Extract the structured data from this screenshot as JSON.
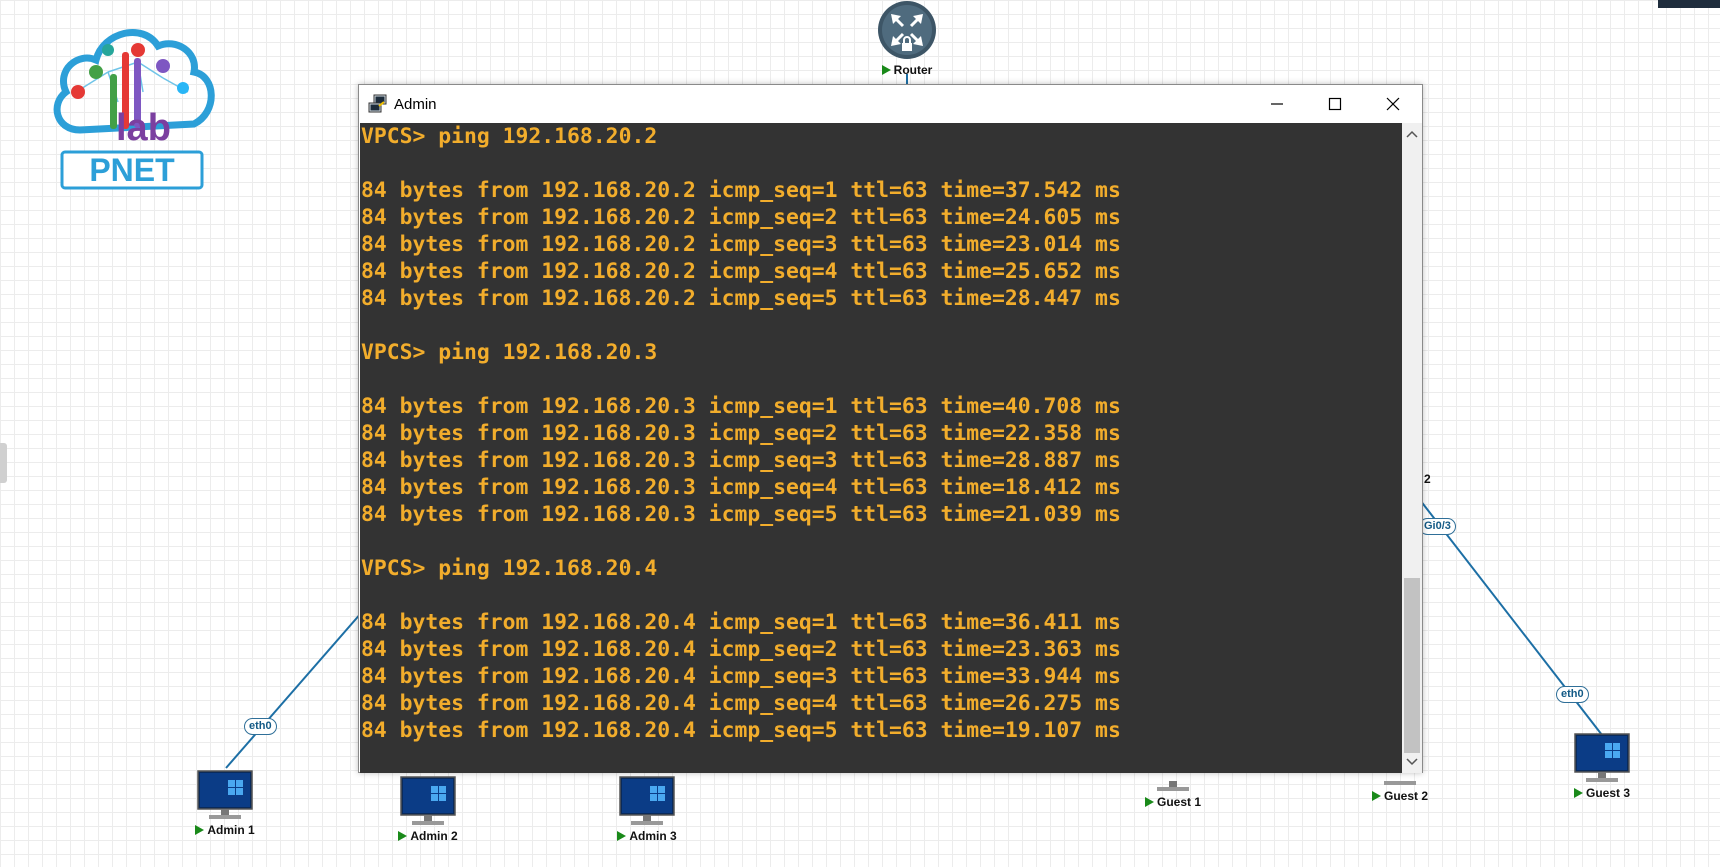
{
  "logo": {
    "text": "PNET",
    "sub_text": "lab"
  },
  "nodes": {
    "router": {
      "label": "Router",
      "icon": "router-icon"
    },
    "admin1": {
      "label": "Admin 1",
      "icon": "pc-icon"
    },
    "admin2": {
      "label": "Admin 2",
      "icon": "pc-icon"
    },
    "admin3": {
      "label": "Admin 3",
      "icon": "pc-icon"
    },
    "guest1": {
      "label": "Guest 1",
      "icon": "pc-icon"
    },
    "guest2": {
      "label": "Guest 2",
      "icon": "pc-icon"
    },
    "guest3": {
      "label": "Guest 3",
      "icon": "pc-icon"
    }
  },
  "interfaces": {
    "admin1_eth": "eth0",
    "guest3_eth": "eth0",
    "switch_gi": "Gi0/3",
    "switch_partial": "2"
  },
  "window": {
    "title": "Admin",
    "icon": "putty-icon",
    "controls": [
      "minimize-icon",
      "maximize-icon",
      "close-icon"
    ]
  },
  "terminal": {
    "text_color": "#f2ad2c",
    "background": "#333333",
    "lines": [
      "VPCS> ping 192.168.20.2",
      "",
      "84 bytes from 192.168.20.2 icmp_seq=1 ttl=63 time=37.542 ms",
      "84 bytes from 192.168.20.2 icmp_seq=2 ttl=63 time=24.605 ms",
      "84 bytes from 192.168.20.2 icmp_seq=3 ttl=63 time=23.014 ms",
      "84 bytes from 192.168.20.2 icmp_seq=4 ttl=63 time=25.652 ms",
      "84 bytes from 192.168.20.2 icmp_seq=5 ttl=63 time=28.447 ms",
      "",
      "VPCS> ping 192.168.20.3",
      "",
      "84 bytes from 192.168.20.3 icmp_seq=1 ttl=63 time=40.708 ms",
      "84 bytes from 192.168.20.3 icmp_seq=2 ttl=63 time=22.358 ms",
      "84 bytes from 192.168.20.3 icmp_seq=3 ttl=63 time=28.887 ms",
      "84 bytes from 192.168.20.3 icmp_seq=4 ttl=63 time=18.412 ms",
      "84 bytes from 192.168.20.3 icmp_seq=5 ttl=63 time=21.039 ms",
      "",
      "VPCS> ping 192.168.20.4",
      "",
      "84 bytes from 192.168.20.4 icmp_seq=1 ttl=63 time=36.411 ms",
      "84 bytes from 192.168.20.4 icmp_seq=2 ttl=63 time=23.363 ms",
      "84 bytes from 192.168.20.4 icmp_seq=3 ttl=63 time=33.944 ms",
      "84 bytes from 192.168.20.4 icmp_seq=4 ttl=63 time=26.275 ms",
      "84 bytes from 192.168.20.4 icmp_seq=5 ttl=63 time=19.107 ms"
    ]
  },
  "colors": {
    "link": "#1d6fa5",
    "play": "#1a8a1a",
    "accent": "#2c9fd8"
  }
}
